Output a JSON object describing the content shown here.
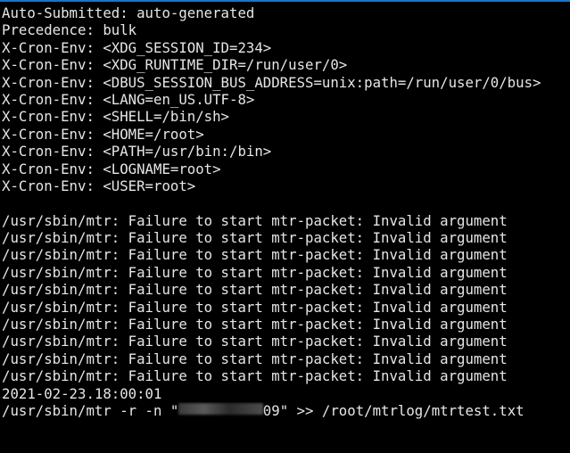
{
  "header_lines": [
    "Auto-Submitted: auto-generated",
    "Precedence: bulk",
    "X-Cron-Env: <XDG_SESSION_ID=234>",
    "X-Cron-Env: <XDG_RUNTIME_DIR=/run/user/0>",
    "X-Cron-Env: <DBUS_SESSION_BUS_ADDRESS=unix:path=/run/user/0/bus>",
    "X-Cron-Env: <LANG=en_US.UTF-8>",
    "X-Cron-Env: <SHELL=/bin/sh>",
    "X-Cron-Env: <HOME=/root>",
    "X-Cron-Env: <PATH=/usr/bin:/bin>",
    "X-Cron-Env: <LOGNAME=root>",
    "X-Cron-Env: <USER=root>"
  ],
  "error_lines": [
    "/usr/sbin/mtr: Failure to start mtr-packet: Invalid argument",
    "/usr/sbin/mtr: Failure to start mtr-packet: Invalid argument",
    "/usr/sbin/mtr: Failure to start mtr-packet: Invalid argument",
    "/usr/sbin/mtr: Failure to start mtr-packet: Invalid argument",
    "/usr/sbin/mtr: Failure to start mtr-packet: Invalid argument",
    "/usr/sbin/mtr: Failure to start mtr-packet: Invalid argument",
    "/usr/sbin/mtr: Failure to start mtr-packet: Invalid argument",
    "/usr/sbin/mtr: Failure to start mtr-packet: Invalid argument",
    "/usr/sbin/mtr: Failure to start mtr-packet: Invalid argument",
    "/usr/sbin/mtr: Failure to start mtr-packet: Invalid argument"
  ],
  "timestamp": "2021-02-23.18:00:01",
  "command": {
    "prefix": "/usr/sbin/mtr -r -n \"",
    "redacted_tail": "09",
    "suffix": "\" >> /root/mtrlog/mtrtest.txt"
  },
  "colors": {
    "background": "#000000",
    "text": "#e6e6e6",
    "accent_bar": "#1a73c7"
  }
}
